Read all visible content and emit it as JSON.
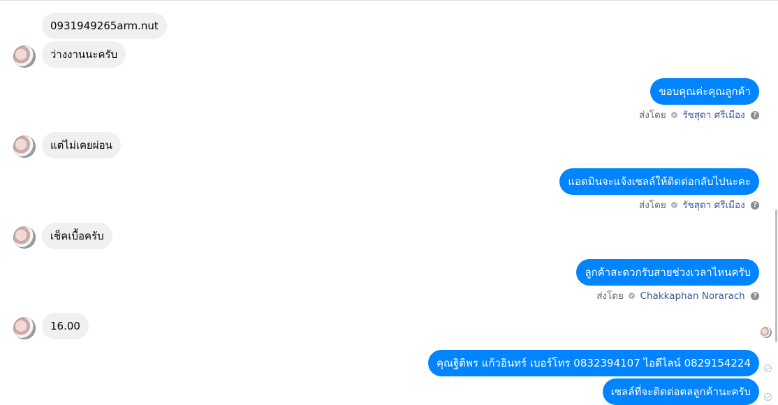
{
  "messages": [
    {
      "text": "0931949265arm.nut"
    },
    {
      "text": "ว่างงานนะครับ"
    },
    {
      "text": "ขอบคุณค่ะคุณลูกค้า",
      "sender": "รัชสุดา ศรีเมือง"
    },
    {
      "text": "แต่ไม่เคยผ่อน"
    },
    {
      "text": "แอดมินจะแจ้งเซลล์ให้ติดต่อกลับไปนะคะ",
      "sender": "รัชสุดา ศรีเมือง"
    },
    {
      "text": "เช็คเบื้อครับ"
    },
    {
      "text": "ลูกค้าสะดวกรับสายช่วงเวลาไหนครับ",
      "sender": "Chakkaphan Norarach"
    },
    {
      "text": "16.00"
    },
    {
      "text": "คุณฐิติพร แก้วอินทร์        เบอร์โทร 0832394107  ไอดีไลน์ 0829154224"
    },
    {
      "text": "เซลล์ที่จะติดต่อตลลูกค้านะครับ"
    }
  ],
  "labels": {
    "sent_by": "ส่งโดย"
  },
  "colors": {
    "outgoing_bubble": "#0084ff",
    "incoming_bubble": "#f0f0f0",
    "sender_name": "#385898"
  }
}
